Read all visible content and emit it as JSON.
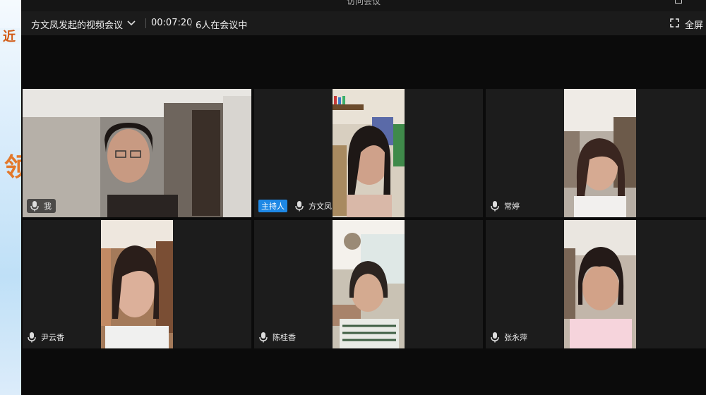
{
  "window": {
    "title": "访问会议",
    "meeting_title": "方文凤发起的视频会议",
    "elapsed": "00:07:20",
    "participant_count": "6人在会议中",
    "fullscreen_label": "全屏"
  },
  "background_slide": {
    "char_top": "近",
    "char_mid": "领"
  },
  "participants": [
    {
      "name": "我",
      "host": false
    },
    {
      "name": "方文凤",
      "host": true,
      "host_label": "主持人"
    },
    {
      "name": "常婷",
      "host": false
    },
    {
      "name": "尹云香",
      "host": false
    },
    {
      "name": "陈桂香",
      "host": false
    },
    {
      "name": "张永萍",
      "host": false
    }
  ],
  "icons": [
    "chevron-down-icon",
    "fullscreen-icon",
    "microphone-icon",
    "maximize-icon"
  ]
}
